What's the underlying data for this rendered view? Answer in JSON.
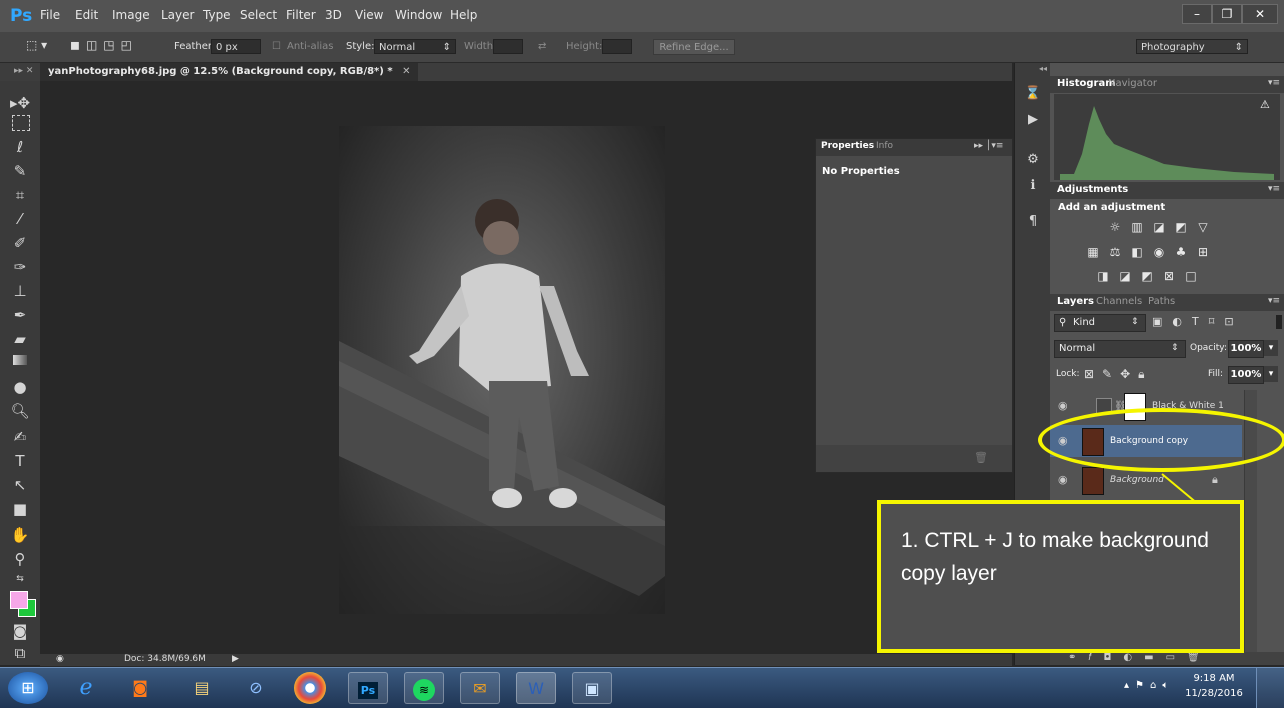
{
  "app": {
    "logo": "Ps"
  },
  "menu": [
    "File",
    "Edit",
    "Image",
    "Layer",
    "Type",
    "Select",
    "Filter",
    "3D",
    "View",
    "Window",
    "Help"
  ],
  "window_controls": {
    "minimize": "–",
    "restore": "❐",
    "close": "✕"
  },
  "options_bar": {
    "feather_label": "Feather:",
    "feather_value": "0 px",
    "antialias_label": "Anti-alias",
    "style_label": "Style:",
    "style_value": "Normal",
    "width_label": "Width:",
    "height_label": "Height:",
    "refine_edge": "Refine Edge...",
    "workspace": "Photography"
  },
  "document_tab": "yanPhotography68.jpg @ 12.5% (Background copy, RGB/8*) *",
  "properties_panel": {
    "tabs": [
      "Properties",
      "Info"
    ],
    "content": "No Properties"
  },
  "histogram_panel": {
    "tabs": [
      "Histogram",
      "Navigator"
    ]
  },
  "adjustments_panel": {
    "title": "Adjustments",
    "subtitle": "Add an adjustment"
  },
  "layers_panel": {
    "tabs": [
      "Layers",
      "Channels",
      "Paths"
    ],
    "filter_kind": "Kind",
    "blend_mode": "Normal",
    "opacity_label": "Opacity:",
    "opacity_value": "100%",
    "lock_label": "Lock:",
    "fill_label": "Fill:",
    "fill_value": "100%",
    "layers": [
      {
        "name": "Black & White 1",
        "selected": false
      },
      {
        "name": "Background copy",
        "selected": true
      },
      {
        "name": "Background",
        "selected": false,
        "locked": true
      }
    ]
  },
  "status_bar": {
    "doc": "Doc: 34.8M/69.6M"
  },
  "annotation": {
    "text": "1. CTRL + J to make background copy layer"
  },
  "taskbar": {
    "clock_time": "9:18 AM",
    "clock_date": "11/28/2016"
  },
  "colors": {
    "annotation": "#f5f500",
    "foreground_swatch": "#f6a7e8",
    "background_swatch": "#1ec83c",
    "selected_layer": "#4d6a8f"
  }
}
